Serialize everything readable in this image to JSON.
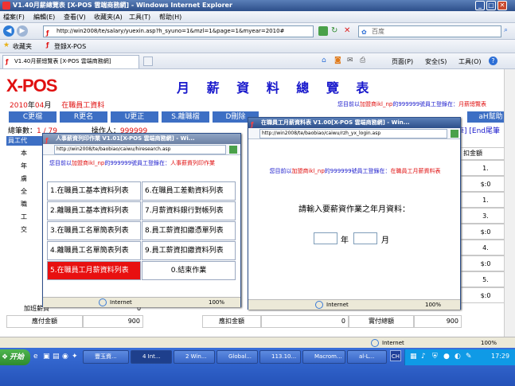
{
  "browser": {
    "title": "V1.40月薪總覽表 [X-POS 雲端商務網] - Windows Internet Explorer",
    "menu": [
      "檔案(F)",
      "編輯(E)",
      "查看(V)",
      "收藏夹(A)",
      "工具(T)",
      "帮助(H)"
    ],
    "address": "http://win2008/te/salary/yuexin.asp?h_syuno=1&mzl=1&page=1&myear=2010#",
    "search_placeholder": "百度",
    "favorites_label": "收藏夹",
    "fav_link": "登錄X-POS",
    "tab_label": "V1.40月薪總覽表 [X-POS 雲端商務網]",
    "cmd_page": "页面(P)",
    "cmd_safety": "安全(S)",
    "cmd_tools": "工具(O)"
  },
  "page": {
    "logo": "X-POS",
    "heading": "月 薪 資 料 總 覽 表",
    "year": "2010",
    "year_unit": "年",
    "month": "04",
    "month_unit": "月",
    "section": "在職員工資料",
    "notice_prefix": "您目前以",
    "notice_company": "加盟商ikl_np",
    "notice_mid": "的999999號員工登錄在：",
    "notice_page": "月薪總覽表",
    "buttons": [
      "C更檔",
      "R更名",
      "U更正",
      "S.離職檔",
      "D刪除",
      "",
      "",
      "",
      "",
      "aH幫助"
    ],
    "right_label": "筆] [End尾筆",
    "total_label": "總筆數：",
    "total_value": "1 / 79",
    "operator_label": "操作人：",
    "operator_value": "999999",
    "emp_label": "員工代",
    "left_col": [
      "本",
      "年",
      "虜",
      "全",
      "職",
      "工",
      "交"
    ],
    "right_col_header": "扣金額",
    "right_col": [
      "1.",
      "$:0",
      "1.",
      "3.",
      "$:0",
      "4.",
      "$:0",
      "5.",
      "$:0"
    ],
    "footer_label1": "加班薪資",
    "footer_value1": "0",
    "footer_label2": "應付金額",
    "footer_value2": "900",
    "footer_label3": "應扣金額",
    "footer_value3": "0",
    "footer_label4": "實付總額",
    "footer_value4": "900"
  },
  "popup1": {
    "title": "人事薪資列印作業 V1.01[X-POS 雲端商務網] - Wi...",
    "address": "http://win2008/te/baobiao/caiwu/hiresearch.asp",
    "notice_prefix": "您目前以",
    "notice_company": "加盟商ikl_np",
    "notice_mid": "的999999號員工登錄在：",
    "notice_page": "人事薪資列印作業",
    "items": [
      "1.在職員工基本資料列表",
      "6.在職員工差勤資料列表",
      "2.離職員工基本資料列表",
      "7.月薪資料銀行對帳列表",
      "3.在職員工名單簡表列表",
      "8.員工薪資扣繳憑單列表",
      "4.離職員工名單簡表列表",
      "9.員工薪資扣繳資料列表",
      "5.在職員工月薪資料列表",
      "0.結束作業"
    ],
    "status": "Internet",
    "zoom": "100%"
  },
  "popup2": {
    "title": "在職員工月薪資料表 V1.00[X-POS 雲端商務網] - Win...",
    "address": "http://win2008/te/baobiao/caiwu/rzh_yx_login.asp",
    "notice_prefix": "您目前以",
    "notice_company": "加盟商ikl_np",
    "notice_mid": "的999999號員工登錄在：",
    "notice_page": "在職員工月薪資料表",
    "prompt": "請輸入要薪資作業之年月資料：",
    "year_unit": "年",
    "month_unit": "月",
    "status": "Internet",
    "zoom": "100%"
  },
  "statusbar": {
    "status": "Internet",
    "zoom": "100%"
  },
  "taskbar": {
    "start": "开始",
    "items": [
      "豐玉資...",
      "4 Int...",
      "2 Win...",
      "Global...",
      "113.10...",
      "Macrom...",
      "al-L..."
    ],
    "lang": "CH",
    "clock": "17:29"
  },
  "colors": {
    "accent_red": "#e01010",
    "link_blue": "#1a1acc",
    "button_blue": "#3d6fc4"
  }
}
